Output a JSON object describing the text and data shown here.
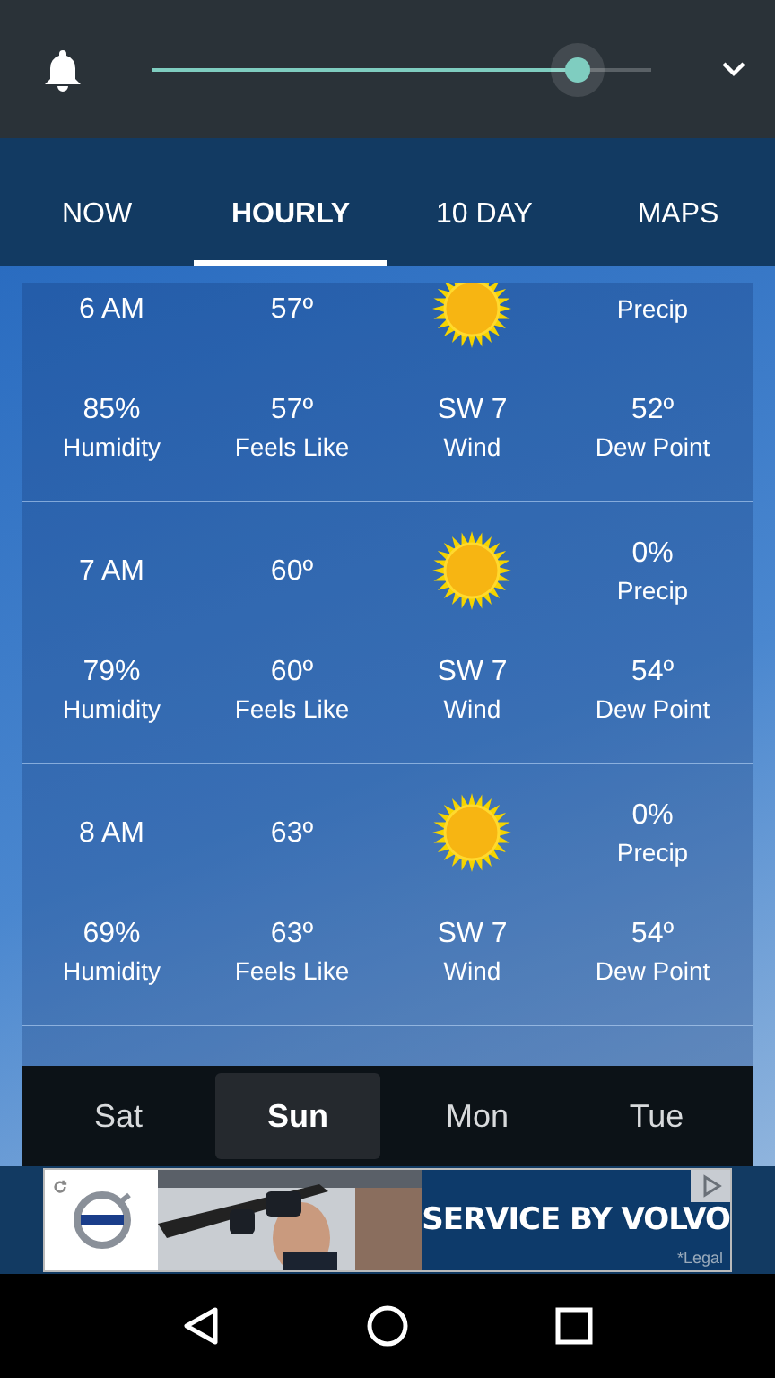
{
  "top_bar": {
    "slider": {
      "level": 0.854
    }
  },
  "tabs": [
    {
      "label": "NOW",
      "selected": false
    },
    {
      "label": "HOURLY",
      "selected": true
    },
    {
      "label": "10 DAY",
      "selected": false
    },
    {
      "label": "MAPS",
      "selected": false
    }
  ],
  "hours": [
    {
      "time": "6 AM",
      "temp": "57º",
      "humidity": "85%",
      "humidity_label": "Humidity",
      "feels_like": "57º",
      "feels_like_label": "Feels Like",
      "wind": "SW 7",
      "wind_label": "Wind",
      "dew_point": "52º",
      "dew_point_label": "Dew Point",
      "precip_label": "Precip"
    },
    {
      "time": "7 AM",
      "temp": "60º",
      "precip": "0%",
      "precip_label": "Precip",
      "humidity": "79%",
      "humidity_label": "Humidity",
      "feels_like": "60º",
      "feels_like_label": "Feels Like",
      "wind": "SW 7",
      "wind_label": "Wind",
      "dew_point": "54º",
      "dew_point_label": "Dew Point"
    },
    {
      "time": "8 AM",
      "temp": "63º",
      "precip": "0%",
      "precip_label": "Precip",
      "humidity": "69%",
      "humidity_label": "Humidity",
      "feels_like": "63º",
      "feels_like_label": "Feels Like",
      "wind": "SW 7",
      "wind_label": "Wind",
      "dew_point": "54º",
      "dew_point_label": "Dew Point"
    }
  ],
  "days": [
    {
      "label": "Sat",
      "selected": false
    },
    {
      "label": "Sun",
      "selected": true
    },
    {
      "label": "Mon",
      "selected": false
    },
    {
      "label": "Tue",
      "selected": false
    }
  ],
  "ad": {
    "headline": "SERVICE BY VOLVO",
    "legal": "*Legal"
  }
}
